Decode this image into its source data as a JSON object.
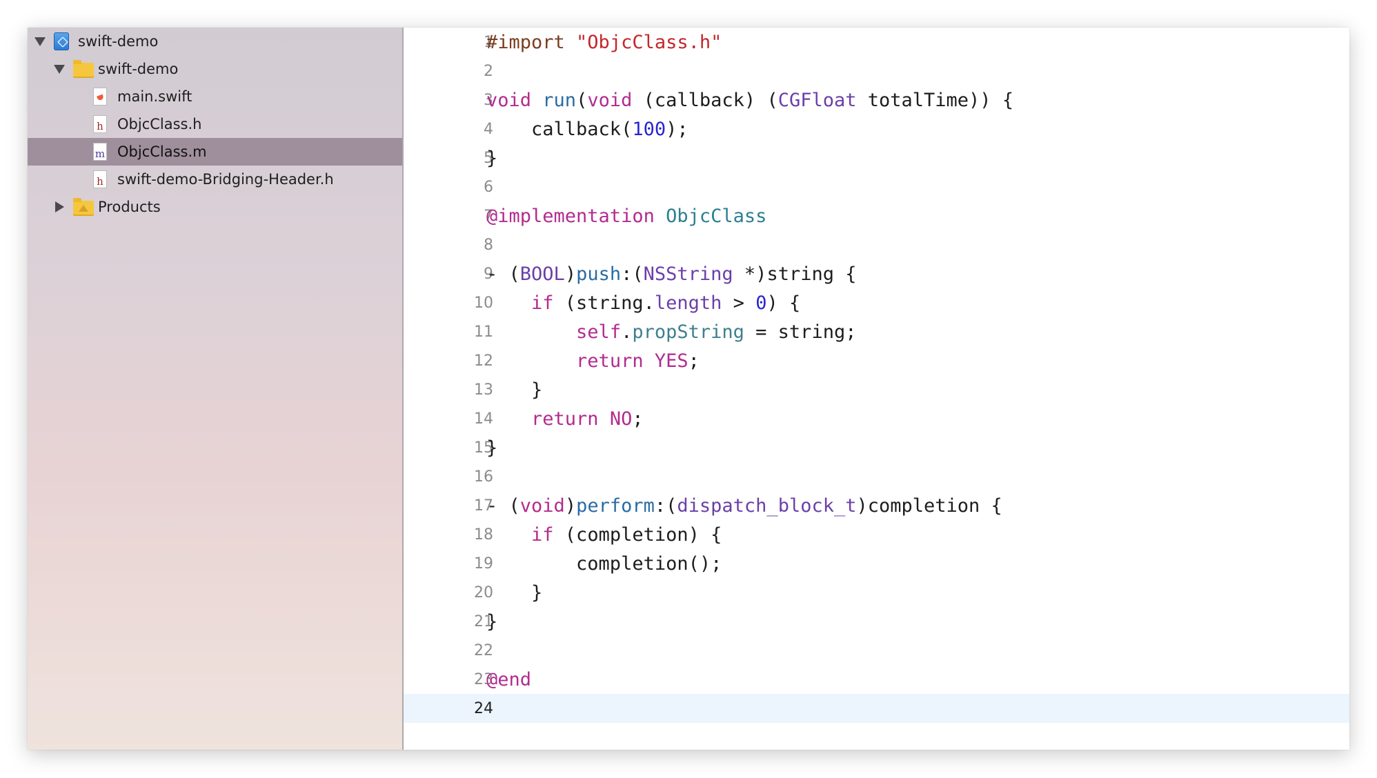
{
  "navigator": {
    "rows": [
      {
        "label": "swift-demo",
        "kind": "project",
        "disclosure": "expanded",
        "selected": false
      },
      {
        "label": "swift-demo",
        "kind": "folder",
        "disclosure": "expanded",
        "selected": false
      },
      {
        "label": "main.swift",
        "kind": "swift",
        "disclosure": "none",
        "selected": false
      },
      {
        "label": "ObjcClass.h",
        "kind": "h",
        "disclosure": "none",
        "selected": false
      },
      {
        "label": "ObjcClass.m",
        "kind": "m",
        "disclosure": "none",
        "selected": true
      },
      {
        "label": "swift-demo-Bridging-Header.h",
        "kind": "h",
        "disclosure": "none",
        "selected": false
      },
      {
        "label": "Products",
        "kind": "products-folder",
        "disclosure": "collapsed",
        "selected": false
      }
    ],
    "icon_glyphs": {
      "h": "h",
      "m": "m"
    }
  },
  "editor": {
    "current_line": 24,
    "lines": [
      {
        "n": "1",
        "tokens": [
          [
            "#import ",
            "prep"
          ],
          [
            "\"ObjcClass.h\"",
            "str"
          ]
        ]
      },
      {
        "n": "2",
        "tokens": []
      },
      {
        "n": "3",
        "tokens": [
          [
            "void",
            "kw"
          ],
          [
            " ",
            "plain"
          ],
          [
            "run",
            "func"
          ],
          [
            "(",
            "plain"
          ],
          [
            "void",
            "kw"
          ],
          [
            " (callback) (",
            "plain"
          ],
          [
            "CGFloat",
            "type"
          ],
          [
            " totalTime)) {",
            "plain"
          ]
        ]
      },
      {
        "n": "4",
        "tokens": [
          [
            "    callback(",
            "plain"
          ],
          [
            "100",
            "num"
          ],
          [
            ");",
            "plain"
          ]
        ]
      },
      {
        "n": "5",
        "tokens": [
          [
            "}",
            "plain"
          ]
        ]
      },
      {
        "n": "6",
        "tokens": []
      },
      {
        "n": "7",
        "tokens": [
          [
            "@implementation",
            "kw"
          ],
          [
            " ",
            "plain"
          ],
          [
            "ObjcClass",
            "teal"
          ]
        ]
      },
      {
        "n": "8",
        "tokens": []
      },
      {
        "n": "9",
        "tokens": [
          [
            "- (",
            "plain"
          ],
          [
            "BOOL",
            "type"
          ],
          [
            ")",
            "plain"
          ],
          [
            "push",
            "func"
          ],
          [
            ":(",
            "plain"
          ],
          [
            "NSString",
            "type"
          ],
          [
            " *)string {",
            "plain"
          ]
        ]
      },
      {
        "n": "10",
        "tokens": [
          [
            "    ",
            "plain"
          ],
          [
            "if",
            "kw"
          ],
          [
            " (string.",
            "plain"
          ],
          [
            "length",
            "type"
          ],
          [
            " > ",
            "plain"
          ],
          [
            "0",
            "num"
          ],
          [
            ") {",
            "plain"
          ]
        ]
      },
      {
        "n": "11",
        "tokens": [
          [
            "        ",
            "plain"
          ],
          [
            "self",
            "kw"
          ],
          [
            ".",
            "plain"
          ],
          [
            "propString",
            "prop"
          ],
          [
            " = string;",
            "plain"
          ]
        ]
      },
      {
        "n": "12",
        "tokens": [
          [
            "        ",
            "plain"
          ],
          [
            "return",
            "kw"
          ],
          [
            " ",
            "plain"
          ],
          [
            "YES",
            "kw"
          ],
          [
            ";",
            "plain"
          ]
        ]
      },
      {
        "n": "13",
        "tokens": [
          [
            "    }",
            "plain"
          ]
        ]
      },
      {
        "n": "14",
        "tokens": [
          [
            "    ",
            "plain"
          ],
          [
            "return",
            "kw"
          ],
          [
            " ",
            "plain"
          ],
          [
            "NO",
            "kw"
          ],
          [
            ";",
            "plain"
          ]
        ]
      },
      {
        "n": "15",
        "tokens": [
          [
            "}",
            "plain"
          ]
        ]
      },
      {
        "n": "16",
        "tokens": []
      },
      {
        "n": "17",
        "tokens": [
          [
            "- (",
            "plain"
          ],
          [
            "void",
            "kw"
          ],
          [
            ")",
            "plain"
          ],
          [
            "perform",
            "func"
          ],
          [
            ":(",
            "plain"
          ],
          [
            "dispatch_block_t",
            "type"
          ],
          [
            ")completion {",
            "plain"
          ]
        ]
      },
      {
        "n": "18",
        "tokens": [
          [
            "    ",
            "plain"
          ],
          [
            "if",
            "kw"
          ],
          [
            " (completion) {",
            "plain"
          ]
        ]
      },
      {
        "n": "19",
        "tokens": [
          [
            "        completion();",
            "plain"
          ]
        ]
      },
      {
        "n": "20",
        "tokens": [
          [
            "    }",
            "plain"
          ]
        ]
      },
      {
        "n": "21",
        "tokens": [
          [
            "}",
            "plain"
          ]
        ]
      },
      {
        "n": "22",
        "tokens": []
      },
      {
        "n": "23",
        "tokens": [
          [
            "@end",
            "kw"
          ]
        ]
      },
      {
        "n": "24",
        "tokens": []
      }
    ]
  },
  "colors": {
    "keyword": "#b22b8f",
    "string": "#c4262c",
    "preprocessor": "#7a3d1f",
    "type": "#6b3fa8",
    "function": "#2a6ba3",
    "number": "#2a26d0",
    "class_name": "#2b7f8f",
    "selection": "#9f8f9c",
    "current_line": "#ecf5fe"
  }
}
